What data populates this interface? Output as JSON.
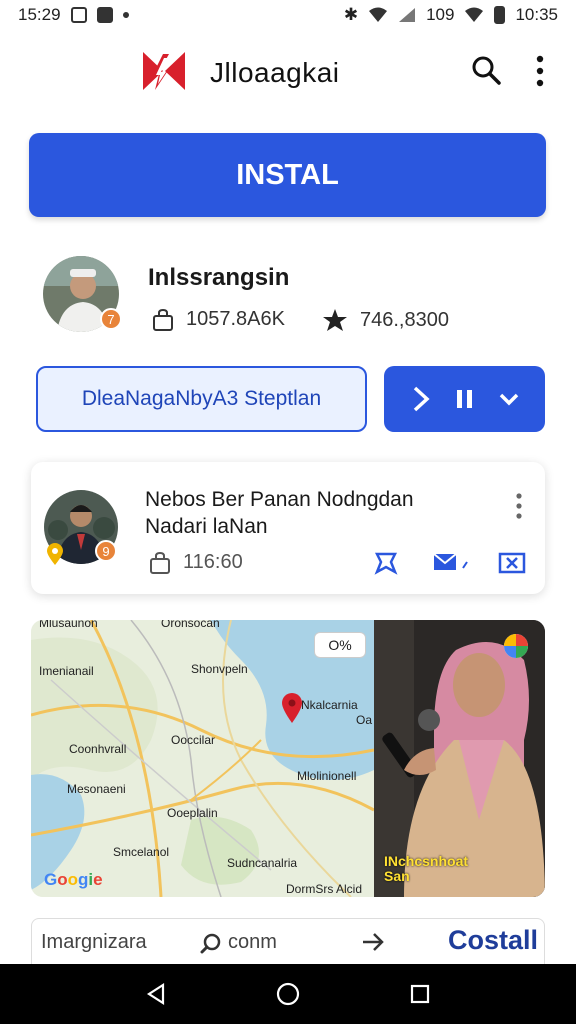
{
  "status_bar": {
    "time_left": "15:29",
    "signal_text": "109",
    "time_right": "10:35"
  },
  "app_bar": {
    "title": "Jlloaagkai",
    "logo_icon": "logo-icon",
    "search_icon": "search-icon",
    "more_icon": "more-vert-icon"
  },
  "install": {
    "label": "INSTAL"
  },
  "profile": {
    "badge": "7",
    "name": "Inlssrangsin",
    "downloads": "1057.8A6K",
    "rating": "746.,8300"
  },
  "actions": {
    "outline_label": "DleaNagaNbyA3 Steptlan",
    "controls": [
      "chevron-right-icon",
      "pause-icon",
      "chevron-down-icon"
    ]
  },
  "card": {
    "title_line1": "Nebos Ber Panan Nodngdan",
    "title_line2": "Nadari laNan",
    "badge": "9",
    "stat": "116:60",
    "actions": [
      "bookmark-icon",
      "share-icon",
      "split-icon"
    ]
  },
  "map": {
    "chip": "O%",
    "labels": {
      "top_left": "Mlusaunon",
      "top_mid": "Oronsocan",
      "l1": "Imenianail",
      "l2": "Shonvpeln",
      "l3": "Nkalcarnia",
      "l4": "Oa",
      "l5": "Ooccilar",
      "l6": "Coonhvrall",
      "l7": "Mlolinionell",
      "l8": "Mesonaeni",
      "l9": "Ooeplalin",
      "l10": "Smcelanol",
      "l11": "Sudncanalria",
      "l12": "DormSrs Alcid"
    },
    "google": [
      "G",
      "o",
      "o",
      "g",
      "i",
      "e"
    ]
  },
  "video": {
    "caption_line1": "INchcsnhoat",
    "caption_line2": "San"
  },
  "bottom_strip": {
    "label": "Imargnizara",
    "search_label": "conm",
    "brand": "Costall"
  },
  "colors": {
    "accent": "#2b57de",
    "brand_dark": "#1f3d9a",
    "badge": "#e8843a",
    "map_pin": "#d8202c"
  }
}
